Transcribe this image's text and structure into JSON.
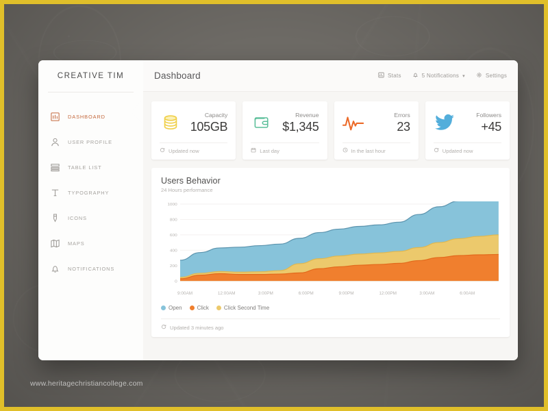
{
  "watermark": "www.heritagechristiancollege.com",
  "sidebar": {
    "brand": "CREATIVE TIM",
    "items": [
      {
        "label": "DASHBOARD",
        "icon": "dashboard-icon",
        "active": true
      },
      {
        "label": "USER PROFILE",
        "icon": "user-icon",
        "active": false
      },
      {
        "label": "TABLE LIST",
        "icon": "table-icon",
        "active": false
      },
      {
        "label": "TYPOGRAPHY",
        "icon": "typography-icon",
        "active": false
      },
      {
        "label": "ICONS",
        "icon": "pen-icon",
        "active": false
      },
      {
        "label": "MAPS",
        "icon": "map-icon",
        "active": false
      },
      {
        "label": "NOTIFICATIONS",
        "icon": "bell-icon",
        "active": false
      }
    ],
    "active_color": "#c4683c"
  },
  "topbar": {
    "title": "Dashboard",
    "stats_label": "Stats",
    "notifications_label": "5 Notifications",
    "notifications_count": 5,
    "settings_label": "Settings"
  },
  "cards": [
    {
      "label": "Capacity",
      "value": "105GB",
      "footer": "Updated now",
      "icon": "database-icon",
      "footer_icon": "refresh-icon",
      "color": "#f2d34e"
    },
    {
      "label": "Revenue",
      "value": "$1,345",
      "footer": "Last day",
      "icon": "wallet-icon",
      "footer_icon": "calendar-icon",
      "color": "#5cbf9a"
    },
    {
      "label": "Errors",
      "value": "23",
      "footer": "In the last hour",
      "icon": "pulse-icon",
      "footer_icon": "clock-icon",
      "color": "#ec6a28"
    },
    {
      "label": "Followers",
      "value": "+45",
      "footer": "Updated now",
      "icon": "twitter-icon",
      "footer_icon": "refresh-icon",
      "color": "#53aedb"
    }
  ],
  "chart_panel": {
    "title": "Users Behavior",
    "subtitle": "24 Hours performance",
    "footer": "Updated 3 minutes ago",
    "footer_icon": "refresh-icon"
  },
  "chart_data": {
    "type": "area",
    "stacked": true,
    "title": "Users Behavior",
    "subtitle": "24 Hours performance",
    "xlabel": "",
    "ylabel": "",
    "ylim": [
      0,
      1000
    ],
    "yticks": [
      0,
      200,
      400,
      600,
      800,
      1000
    ],
    "grid": true,
    "legend_position": "bottom-left",
    "categories": [
      "9:00AM",
      "12:00AM",
      "3:00PM",
      "6:00PM",
      "9:00PM",
      "12:00PM",
      "3:00AM",
      "6:00AM"
    ],
    "x": [
      0,
      1,
      2,
      3,
      4,
      5,
      6,
      7,
      8,
      9,
      10,
      11,
      12,
      13,
      14,
      15,
      16
    ],
    "series": [
      {
        "name": "Click",
        "color": "#f07f2e",
        "values": [
          30,
          75,
          95,
          85,
          85,
          90,
          105,
          160,
          185,
          205,
          215,
          230,
          265,
          305,
          330,
          340,
          345
        ]
      },
      {
        "name": "Click Second Time",
        "color": "#ecc96c",
        "values": [
          18,
          25,
          28,
          30,
          35,
          45,
          120,
          130,
          140,
          145,
          150,
          155,
          170,
          195,
          220,
          240,
          255
        ]
      },
      {
        "name": "Open",
        "color": "#87c3da",
        "values": [
          222,
          270,
          307,
          325,
          340,
          345,
          330,
          340,
          350,
          360,
          365,
          380,
          430,
          465,
          490,
          510,
          530
        ]
      }
    ],
    "legend": [
      "Open",
      "Click",
      "Click Second Time"
    ]
  }
}
